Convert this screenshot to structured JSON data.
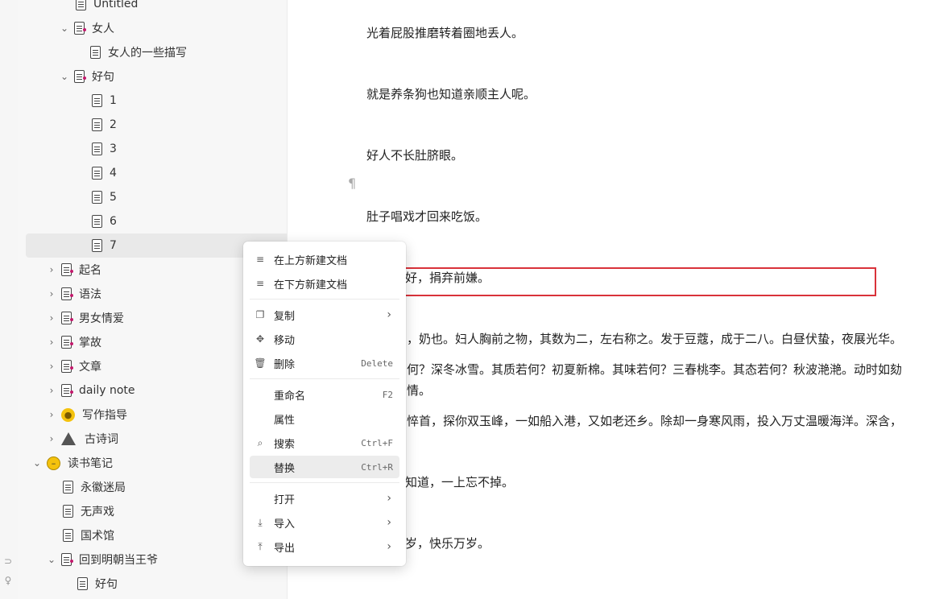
{
  "tree": {
    "items": [
      {
        "label": "Untitled",
        "icon": "document-icon",
        "arrow": ""
      },
      {
        "label": "女人",
        "icon": "document-icon",
        "arrow": "chevron-down"
      },
      {
        "label": "女人的一些描写",
        "icon": "document-icon",
        "arrow": ""
      },
      {
        "label": "好句",
        "icon": "document-icon",
        "arrow": "chevron-down"
      },
      {
        "label": "1",
        "icon": "document-icon",
        "arrow": ""
      },
      {
        "label": "2",
        "icon": "document-icon",
        "arrow": ""
      },
      {
        "label": "3",
        "icon": "document-icon",
        "arrow": ""
      },
      {
        "label": "4",
        "icon": "document-icon",
        "arrow": ""
      },
      {
        "label": "5",
        "icon": "document-icon",
        "arrow": ""
      },
      {
        "label": "6",
        "icon": "document-icon",
        "arrow": ""
      },
      {
        "label": "7",
        "icon": "document-icon",
        "arrow": ""
      },
      {
        "label": "起名",
        "icon": "document-icon",
        "arrow": "chevron-right"
      },
      {
        "label": "语法",
        "icon": "document-icon",
        "arrow": "chevron-right"
      },
      {
        "label": "男女情爱",
        "icon": "document-icon",
        "arrow": "chevron-right"
      },
      {
        "label": "掌故",
        "icon": "document-icon",
        "arrow": "chevron-right"
      },
      {
        "label": "文章",
        "icon": "document-icon",
        "arrow": "chevron-right"
      },
      {
        "label": "daily note",
        "icon": "document-icon",
        "arrow": "chevron-right"
      },
      {
        "label": "写作指导",
        "icon": "emoji-icon",
        "arrow": "chevron-right"
      },
      {
        "label": "古诗词",
        "icon": "mountain-icon",
        "arrow": "chevron-right"
      },
      {
        "label": "读书笔记",
        "icon": "emoji-icon",
        "arrow": "chevron-down"
      },
      {
        "label": "永徽迷局",
        "icon": "document-icon",
        "arrow": ""
      },
      {
        "label": "无声戏",
        "icon": "document-icon",
        "arrow": ""
      },
      {
        "label": "国术馆",
        "icon": "document-icon",
        "arrow": ""
      },
      {
        "label": "回到明朝当王爷",
        "icon": "document-icon",
        "arrow": "chevron-down"
      },
      {
        "label": "好句",
        "icon": "document-icon",
        "arrow": ""
      }
    ]
  },
  "editor": {
    "paragraphs": [
      "光着屁股推磨转着圈地丢人。",
      "就是养条狗也知道亲顺主人呢。",
      "好人不长肚脐眼。",
      "肚子唱戏才回来吃饭。",
      "好，捐弃前嫌。",
      "，奶也。妇人胸前之物，其数为二，左右称之。发于豆蔻，成于二八。白昼伏蛰，夜展光华。",
      "何？深冬冰雪。其质若何？初夏新棉。其味若何？三春桃李。其态若何？秋波滟滟。动时如劾",
      "情。",
      "悴首，探你双玉峰，一如船入港，又如老还乡。除却一身寒风雨，投入万丈温暖海洋。深含，",
      "知道，一上忘不掉。",
      "岁，快乐万岁。"
    ],
    "pilcrow": "¶"
  },
  "context_menu": {
    "new_above": "在上方新建文档",
    "new_below": "在下方新建文档",
    "copy": "复制",
    "move": "移动",
    "delete": "删除",
    "delete_shortcut": "Delete",
    "rename": "重命名",
    "rename_shortcut": "F2",
    "properties": "属性",
    "search": "搜索",
    "search_shortcut": "Ctrl+F",
    "replace": "替换",
    "replace_shortcut": "Ctrl+R",
    "open": "打开",
    "import": "导入",
    "export": "导出"
  },
  "colors": {
    "highlight_border": "#d9323a",
    "pink_dot": "#c2186b"
  }
}
